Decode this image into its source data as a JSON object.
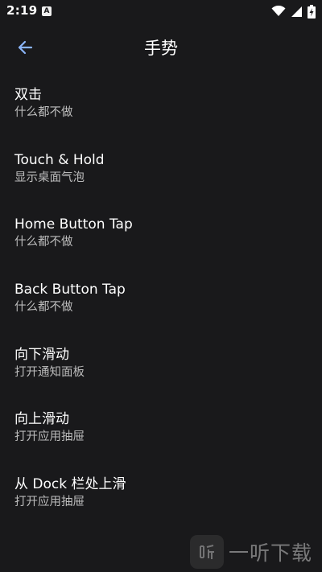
{
  "status_bar": {
    "time": "2:19",
    "notification_letter": "A",
    "icons": [
      "wifi-icon",
      "signal-icon",
      "battery-charging-icon"
    ]
  },
  "app_bar": {
    "title": "手势",
    "back_icon": "arrow-left-icon",
    "accent_color": "#8ab4f8"
  },
  "settings": [
    {
      "title": "双击",
      "value": "什么都不做"
    },
    {
      "title": "Touch & Hold",
      "value": "显示桌面气泡"
    },
    {
      "title": "Home Button Tap",
      "value": "什么都不做"
    },
    {
      "title": "Back Button Tap",
      "value": "什么都不做"
    },
    {
      "title": "向下滑动",
      "value": "打开通知面板"
    },
    {
      "title": "向上滑动",
      "value": "打开应用抽屉"
    },
    {
      "title": "从 Dock 栏处上滑",
      "value": "打开应用抽屉"
    }
  ],
  "watermark": {
    "text": "一听下载"
  }
}
